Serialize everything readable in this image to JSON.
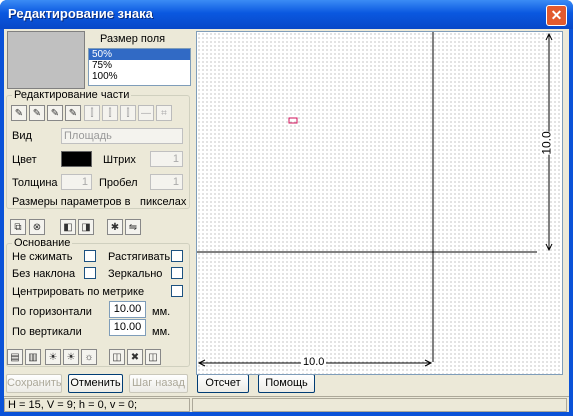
{
  "window": {
    "title": "Редактирование знака",
    "close_symbol": "✕"
  },
  "field_size": {
    "label": "Размер поля",
    "options": [
      "50%",
      "75%",
      "100%"
    ],
    "selected": "50%"
  },
  "part_edit": {
    "label": "Редактирование части",
    "view_label": "Вид",
    "view_value": "Площадь",
    "color_label": "Цвет",
    "stroke_label": "Штрих",
    "stroke_value": "1",
    "thickness_label": "Толщина",
    "thickness_value": "1",
    "gap_label": "Пробел",
    "gap_value": "1",
    "units_label": "Размеры параметров в",
    "units_value": "пикселах",
    "color": "#000000"
  },
  "base": {
    "label": "Основание",
    "no_compress": "Не сжимать",
    "stretch": "Растягивать",
    "no_slant": "Без наклона",
    "mirror": "Зеркально",
    "center_metric": "Центрировать по метрике",
    "horizontal_label": "По горизонтали",
    "horizontal_value": "10.00",
    "vertical_label": "По вертикали",
    "vertical_value": "10.00",
    "unit": "мм."
  },
  "buttons": {
    "save": "Сохранить",
    "cancel": "Отменить",
    "step_back": "Шаг назад",
    "reference": "Отсчет",
    "help": "Помощь"
  },
  "canvas": {
    "h_dim": "10.0",
    "v_dim": "10.0"
  },
  "status": {
    "coords": "H = 15, V = 9; h = 0, v = 0;"
  }
}
